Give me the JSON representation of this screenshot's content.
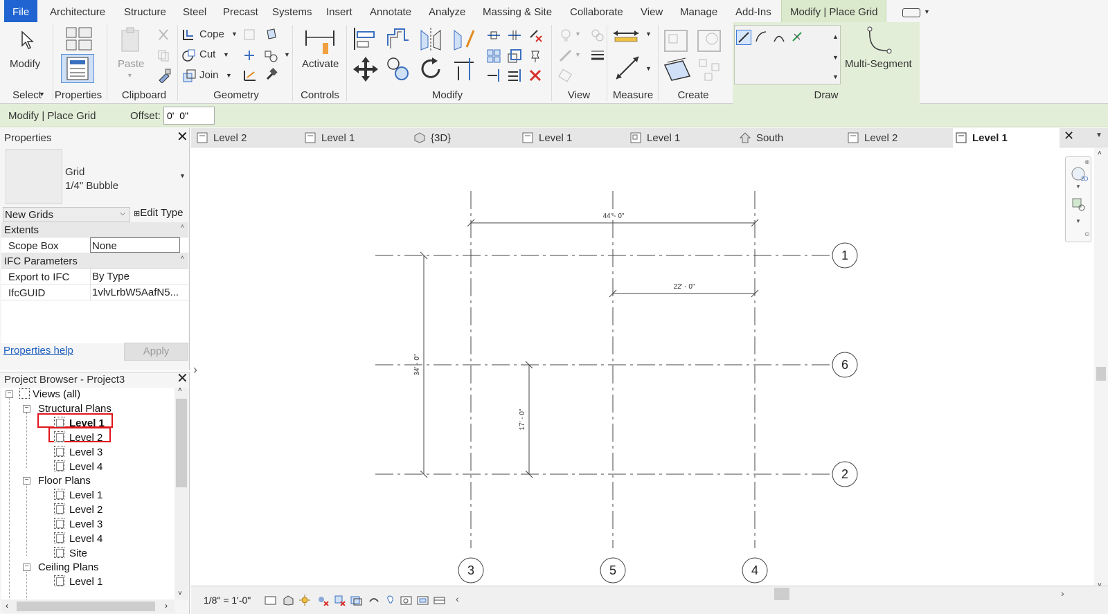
{
  "ribbon_tabs": [
    "File",
    "Architecture",
    "Structure",
    "Steel",
    "Precast",
    "Systems",
    "Insert",
    "Annotate",
    "Analyze",
    "Massing & Site",
    "Collaborate",
    "View",
    "Manage",
    "Add-Ins",
    "Modify | Place Grid"
  ],
  "ribbon": {
    "modify_label": "Modify",
    "select_label": "Select",
    "properties_label": "Properties",
    "paste_label": "Paste",
    "clipboard_label": "Clipboard",
    "cope_label": "Cope",
    "cut_label": "Cut",
    "join_label": "Join",
    "geometry_label": "Geometry",
    "activate_label": "Activate",
    "controls_label": "Controls",
    "modify_panel_label": "Modify",
    "view_label": "View",
    "measure_label": "Measure",
    "create_label": "Create",
    "draw_label": "Draw",
    "multi_segment_label": "Multi-Segment"
  },
  "options_bar": {
    "context": "Modify | Place Grid",
    "offset_label": "Offset:",
    "offset_value": "0'  0\""
  },
  "view_tabs": [
    {
      "label": "Level 2",
      "icon": "plan-view-icon"
    },
    {
      "label": "Level 1",
      "icon": "plan-view-icon"
    },
    {
      "label": "{3D}",
      "icon": "3d-view-icon"
    },
    {
      "label": "Level 1",
      "icon": "plan-view-icon"
    },
    {
      "label": "Level 1",
      "icon": "ceiling-plan-icon"
    },
    {
      "label": "South",
      "icon": "elevation-view-icon"
    },
    {
      "label": "Level 2",
      "icon": "plan-view-icon"
    },
    {
      "label": "Level 1",
      "icon": "plan-view-icon"
    }
  ],
  "properties": {
    "title": "Properties",
    "type_name": "Grid",
    "type_sub": "1/4\" Bubble",
    "instance_filter": "New Grids",
    "edit_type": "Edit Type",
    "sections": [
      {
        "name": "Extents",
        "rows": [
          {
            "key": "Scope Box",
            "value": "None"
          }
        ]
      },
      {
        "name": "IFC Parameters",
        "rows": [
          {
            "key": "Export to IFC",
            "value": "By Type"
          },
          {
            "key": "IfcGUID",
            "value": "1vlvLrbW5AafN5..."
          }
        ]
      }
    ],
    "help_link": "Properties help",
    "apply_label": "Apply"
  },
  "project_browser": {
    "title": "Project Browser - Project3",
    "root": "Views (all)",
    "groups": [
      {
        "name": "Structural Plans",
        "items": [
          "Level 1",
          "Level 2",
          "Level 3",
          "Level 4"
        ]
      },
      {
        "name": "Floor Plans",
        "items": [
          "Level 1",
          "Level 2",
          "Level 3",
          "Level 4",
          "Site"
        ]
      },
      {
        "name": "Ceiling Plans",
        "items": [
          "Level 1"
        ]
      }
    ]
  },
  "grid": {
    "vertical_grids": [
      "3",
      "5",
      "4"
    ],
    "horizontal_grids": [
      "1",
      "6",
      "2"
    ],
    "dimensions": {
      "top": "44' - 0\"",
      "middle": "22' - 0\"",
      "left": "34' - 0\"",
      "inner": "17' - 0\""
    }
  },
  "status_bar": {
    "scale": "1/8\" = 1'-0\""
  },
  "colors": {
    "file_tab": "#1f64d1",
    "context_tab": "#dbe9cc",
    "highlight": "#e0161b"
  }
}
